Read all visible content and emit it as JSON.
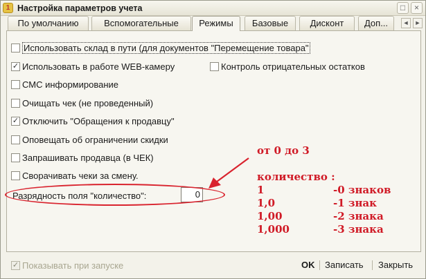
{
  "window": {
    "title": "Настройка параметров учета",
    "minimize_glyph": "□",
    "close_glyph": "×"
  },
  "tabs": [
    {
      "label": "По умолчанию"
    },
    {
      "label": "Вспомогательные"
    },
    {
      "label": "Режимы"
    },
    {
      "label": "Базовые"
    },
    {
      "label": "Дисконт"
    },
    {
      "label": "Доп..."
    }
  ],
  "tab_scroll": {
    "left": "◄",
    "right": "►"
  },
  "options": [
    {
      "label": "Использовать склад в пути (для документов \"Перемещение товара\"",
      "checked": false
    },
    {
      "label": "Использовать в работе WEB-камеру",
      "checked": true
    },
    {
      "label": "Контроль отрицательных остатков",
      "checked": false
    },
    {
      "label": "СМС информирование",
      "checked": false
    },
    {
      "label": "Очищать чек (не проведенный)",
      "checked": false
    },
    {
      "label": "Отключить \"Обращения к продавцу\"",
      "checked": true
    },
    {
      "label": "Оповещать об ограничении скидки",
      "checked": false
    },
    {
      "label": "Запрашивать продавца (в ЧЕК)",
      "checked": false
    },
    {
      "label": "Сворачивать чеки за смену.",
      "checked": false
    }
  ],
  "check_mark": "✓",
  "quantity_field": {
    "label": "Разрядность поля \"количество\":",
    "value": "0"
  },
  "annotation": {
    "range": "от 0 до 3",
    "heading": "количество :",
    "rows": [
      {
        "value": "1",
        "desc": "-0 знаков"
      },
      {
        "value": "1,0",
        "desc": "-1 знак"
      },
      {
        "value": "1,00",
        "desc": "-2 знака"
      },
      {
        "value": "1,000",
        "desc": "-3 знака"
      }
    ],
    "color": "#d01a26"
  },
  "footer": {
    "show_on_start": {
      "label": "Показывать при запуске",
      "checked": true,
      "disabled": true
    },
    "ok": "OK",
    "save": "Записать",
    "close": "Закрыть"
  }
}
